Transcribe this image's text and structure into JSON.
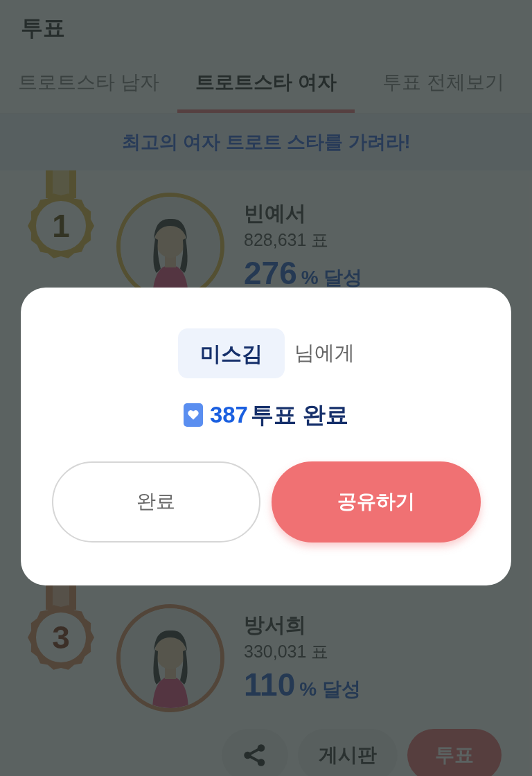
{
  "header": {
    "title": "투표"
  },
  "tabs": [
    {
      "label": "트로트스타 남자",
      "selected": false
    },
    {
      "label": "트로트스타 여자",
      "selected": true
    },
    {
      "label": "투표 전체보기",
      "selected": false
    }
  ],
  "banner": "최고의 여자 트로트 스타를 가려라!",
  "ranking": [
    {
      "rank": "1",
      "kind": "gold",
      "name": "빈예서",
      "votes": "828,631 표",
      "percent": "276",
      "percent_label": "% 달성"
    },
    {
      "rank": "3",
      "kind": "bronze",
      "name": "방서희",
      "votes": "330,031 표",
      "percent": "110",
      "percent_label": "% 달성",
      "buttons": [
        {
          "kind": "share"
        },
        {
          "kind": "board",
          "label": "게시판"
        },
        {
          "kind": "vote",
          "label": "투표"
        }
      ]
    }
  ],
  "dialog": {
    "recipient": "미스김",
    "recipient_suffix": "님에게",
    "count": "387",
    "result": "투표 완료",
    "buttons": [
      {
        "kind": "secondary",
        "label": "완료"
      },
      {
        "kind": "primary",
        "label": "공유하기"
      }
    ]
  }
}
